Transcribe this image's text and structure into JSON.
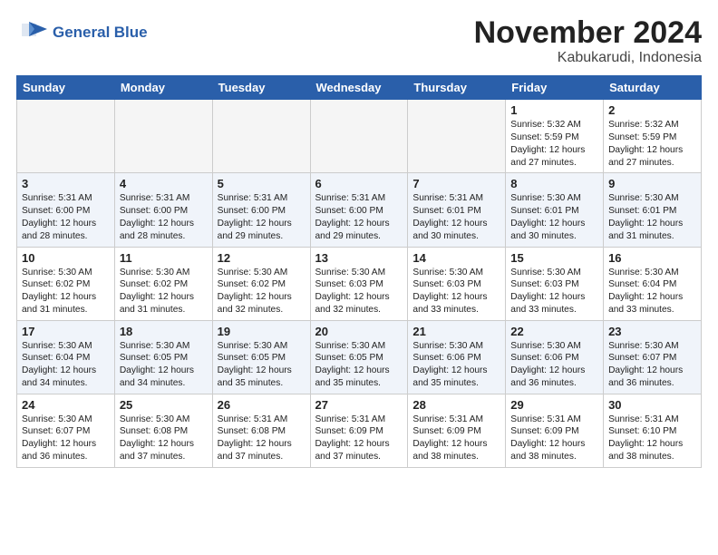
{
  "header": {
    "logo_line1": "General",
    "logo_line2": "Blue",
    "month": "November 2024",
    "location": "Kabukarudi, Indonesia"
  },
  "weekdays": [
    "Sunday",
    "Monday",
    "Tuesday",
    "Wednesday",
    "Thursday",
    "Friday",
    "Saturday"
  ],
  "weeks": [
    [
      {
        "day": "",
        "info": ""
      },
      {
        "day": "",
        "info": ""
      },
      {
        "day": "",
        "info": ""
      },
      {
        "day": "",
        "info": ""
      },
      {
        "day": "",
        "info": ""
      },
      {
        "day": "1",
        "info": "Sunrise: 5:32 AM\nSunset: 5:59 PM\nDaylight: 12 hours\nand 27 minutes."
      },
      {
        "day": "2",
        "info": "Sunrise: 5:32 AM\nSunset: 5:59 PM\nDaylight: 12 hours\nand 27 minutes."
      }
    ],
    [
      {
        "day": "3",
        "info": "Sunrise: 5:31 AM\nSunset: 6:00 PM\nDaylight: 12 hours\nand 28 minutes."
      },
      {
        "day": "4",
        "info": "Sunrise: 5:31 AM\nSunset: 6:00 PM\nDaylight: 12 hours\nand 28 minutes."
      },
      {
        "day": "5",
        "info": "Sunrise: 5:31 AM\nSunset: 6:00 PM\nDaylight: 12 hours\nand 29 minutes."
      },
      {
        "day": "6",
        "info": "Sunrise: 5:31 AM\nSunset: 6:00 PM\nDaylight: 12 hours\nand 29 minutes."
      },
      {
        "day": "7",
        "info": "Sunrise: 5:31 AM\nSunset: 6:01 PM\nDaylight: 12 hours\nand 30 minutes."
      },
      {
        "day": "8",
        "info": "Sunrise: 5:30 AM\nSunset: 6:01 PM\nDaylight: 12 hours\nand 30 minutes."
      },
      {
        "day": "9",
        "info": "Sunrise: 5:30 AM\nSunset: 6:01 PM\nDaylight: 12 hours\nand 31 minutes."
      }
    ],
    [
      {
        "day": "10",
        "info": "Sunrise: 5:30 AM\nSunset: 6:02 PM\nDaylight: 12 hours\nand 31 minutes."
      },
      {
        "day": "11",
        "info": "Sunrise: 5:30 AM\nSunset: 6:02 PM\nDaylight: 12 hours\nand 31 minutes."
      },
      {
        "day": "12",
        "info": "Sunrise: 5:30 AM\nSunset: 6:02 PM\nDaylight: 12 hours\nand 32 minutes."
      },
      {
        "day": "13",
        "info": "Sunrise: 5:30 AM\nSunset: 6:03 PM\nDaylight: 12 hours\nand 32 minutes."
      },
      {
        "day": "14",
        "info": "Sunrise: 5:30 AM\nSunset: 6:03 PM\nDaylight: 12 hours\nand 33 minutes."
      },
      {
        "day": "15",
        "info": "Sunrise: 5:30 AM\nSunset: 6:03 PM\nDaylight: 12 hours\nand 33 minutes."
      },
      {
        "day": "16",
        "info": "Sunrise: 5:30 AM\nSunset: 6:04 PM\nDaylight: 12 hours\nand 33 minutes."
      }
    ],
    [
      {
        "day": "17",
        "info": "Sunrise: 5:30 AM\nSunset: 6:04 PM\nDaylight: 12 hours\nand 34 minutes."
      },
      {
        "day": "18",
        "info": "Sunrise: 5:30 AM\nSunset: 6:05 PM\nDaylight: 12 hours\nand 34 minutes."
      },
      {
        "day": "19",
        "info": "Sunrise: 5:30 AM\nSunset: 6:05 PM\nDaylight: 12 hours\nand 35 minutes."
      },
      {
        "day": "20",
        "info": "Sunrise: 5:30 AM\nSunset: 6:05 PM\nDaylight: 12 hours\nand 35 minutes."
      },
      {
        "day": "21",
        "info": "Sunrise: 5:30 AM\nSunset: 6:06 PM\nDaylight: 12 hours\nand 35 minutes."
      },
      {
        "day": "22",
        "info": "Sunrise: 5:30 AM\nSunset: 6:06 PM\nDaylight: 12 hours\nand 36 minutes."
      },
      {
        "day": "23",
        "info": "Sunrise: 5:30 AM\nSunset: 6:07 PM\nDaylight: 12 hours\nand 36 minutes."
      }
    ],
    [
      {
        "day": "24",
        "info": "Sunrise: 5:30 AM\nSunset: 6:07 PM\nDaylight: 12 hours\nand 36 minutes."
      },
      {
        "day": "25",
        "info": "Sunrise: 5:30 AM\nSunset: 6:08 PM\nDaylight: 12 hours\nand 37 minutes."
      },
      {
        "day": "26",
        "info": "Sunrise: 5:31 AM\nSunset: 6:08 PM\nDaylight: 12 hours\nand 37 minutes."
      },
      {
        "day": "27",
        "info": "Sunrise: 5:31 AM\nSunset: 6:09 PM\nDaylight: 12 hours\nand 37 minutes."
      },
      {
        "day": "28",
        "info": "Sunrise: 5:31 AM\nSunset: 6:09 PM\nDaylight: 12 hours\nand 38 minutes."
      },
      {
        "day": "29",
        "info": "Sunrise: 5:31 AM\nSunset: 6:09 PM\nDaylight: 12 hours\nand 38 minutes."
      },
      {
        "day": "30",
        "info": "Sunrise: 5:31 AM\nSunset: 6:10 PM\nDaylight: 12 hours\nand 38 minutes."
      }
    ]
  ]
}
